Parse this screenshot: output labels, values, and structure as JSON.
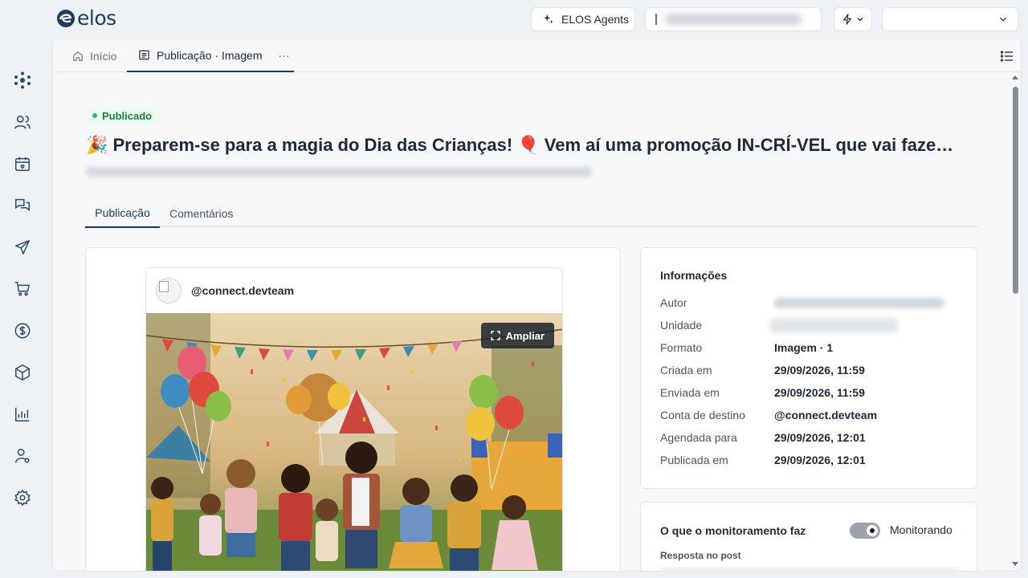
{
  "brand": {
    "name": "elos"
  },
  "topbar": {
    "agents_label": "ELOS Agents",
    "account_select_value": ""
  },
  "tabs": {
    "home_label": "Início",
    "active_label": "Publicação · Imagem",
    "more_label": "···"
  },
  "publication": {
    "status": "Publicado",
    "title": "🎉 Preparem-se para a magia do Dia das Crianças! 🎈 Vem aí uma promoção IN-CRÍ-VEL que vai faze…",
    "subtabs": [
      "Publicação",
      "Comentários"
    ]
  },
  "post": {
    "account": "@connect.devteam",
    "expand_label": "Ampliar"
  },
  "info": {
    "title": "Informações",
    "rows": [
      {
        "label": "Autor",
        "value": ""
      },
      {
        "label": "Unidade",
        "value": ""
      },
      {
        "label": "Formato",
        "value": "Imagem · 1"
      },
      {
        "label": "Criada em",
        "value": "29/09/2026, 11:59"
      },
      {
        "label": "Enviada em",
        "value": "29/09/2026, 11:59"
      },
      {
        "label": "Conta de destino",
        "value": "@connect.devteam"
      },
      {
        "label": "Agendada para",
        "value": "29/09/2026, 12:01"
      },
      {
        "label": "Publicada em",
        "value": "29/09/2026, 12:01"
      }
    ]
  },
  "monitoring": {
    "title": "O que o monitoramento faz",
    "toggle_label": "Monitorando",
    "toggle_on": true,
    "section_label": "Resposta no post"
  },
  "sidebar": {
    "items": [
      "hub-icon",
      "users-icon",
      "calendar-icon",
      "chat-icon",
      "send-icon",
      "cart-icon",
      "dollar-icon",
      "box-icon",
      "chart-icon",
      "user-settings-icon",
      "gear-icon"
    ]
  }
}
